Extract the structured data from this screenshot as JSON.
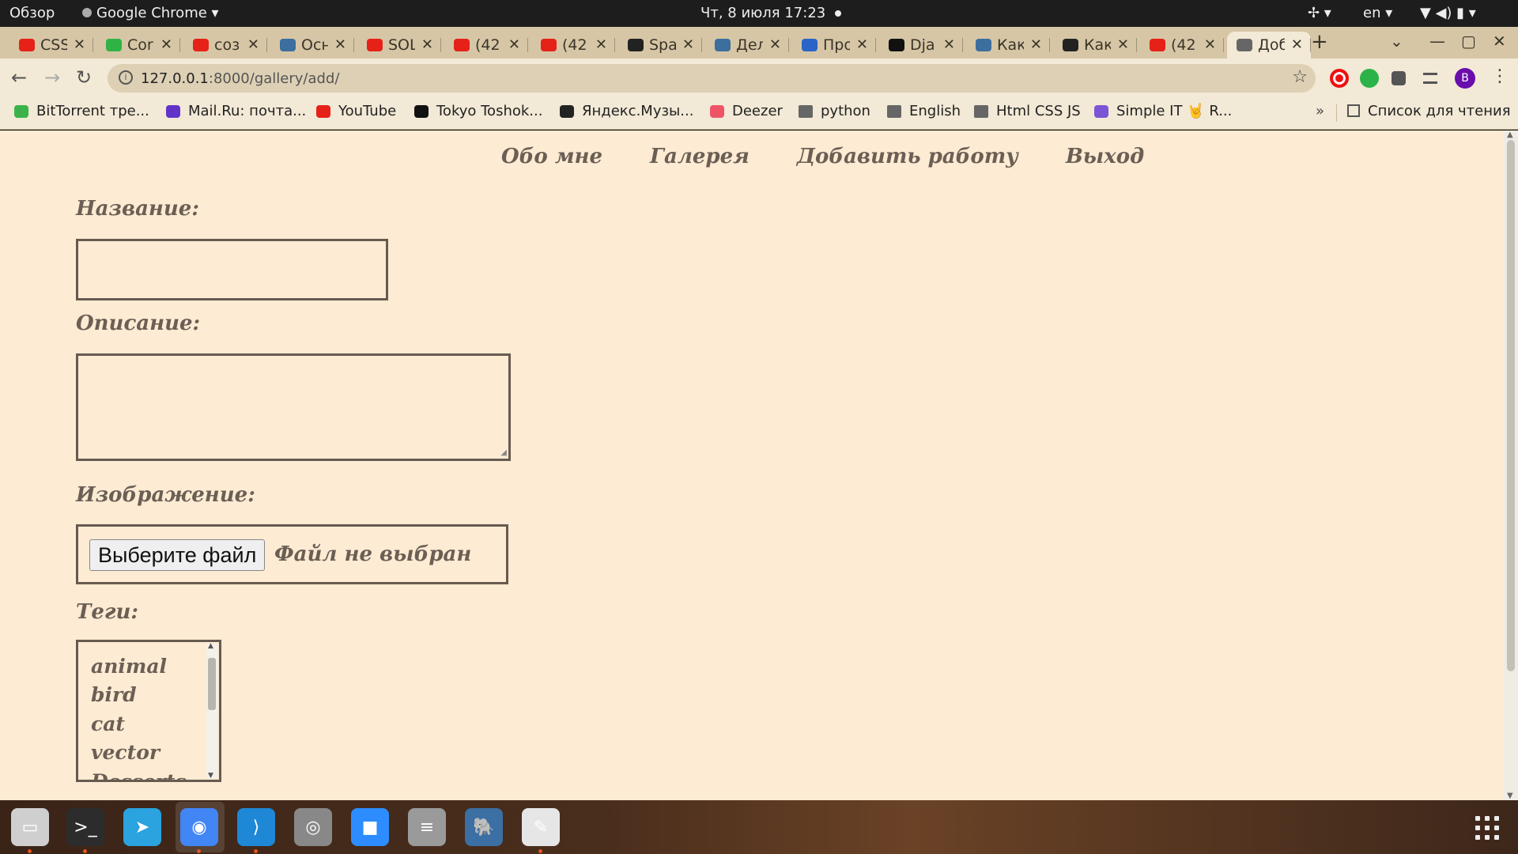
{
  "topbar": {
    "activities": "Обзор",
    "app_menu": "Google Chrome ▾",
    "datetime": "Чт, 8 июля  17:23",
    "lang": "en ▾",
    "a11y": "✢ ▾",
    "status": "▼ ◀) ▮ ▾"
  },
  "tabs": [
    {
      "title": "CSS",
      "color": "#e62117"
    },
    {
      "title": "Cor",
      "color": "#2fb344"
    },
    {
      "title": "соз",
      "color": "#e62117"
    },
    {
      "title": "Осн",
      "color": "#3c6e9e"
    },
    {
      "title": "SOL",
      "color": "#e62117"
    },
    {
      "title": "(42",
      "color": "#e62117"
    },
    {
      "title": "(42",
      "color": "#e62117"
    },
    {
      "title": "Spa",
      "color": "#222222"
    },
    {
      "title": "Дел",
      "color": "#3c6e9e"
    },
    {
      "title": "Про",
      "color": "#2a64c6"
    },
    {
      "title": "Dja",
      "color": "#111111"
    },
    {
      "title": "Как",
      "color": "#3c6e9e"
    },
    {
      "title": "Как",
      "color": "#222222"
    },
    {
      "title": "(42",
      "color": "#e62117"
    },
    {
      "title": "Доб",
      "color": "#666666"
    }
  ],
  "tab_close": "✕",
  "new_tab": "+",
  "window": {
    "tabsearch": "⌄",
    "minimize": "—",
    "restore": "▢",
    "close": "✕"
  },
  "toolbar": {
    "back": "←",
    "forward": "→",
    "reload": "↻",
    "url_host": "127.0.0.1",
    "url_rest": ":8000/gallery/add/",
    "info": "i",
    "star": "☆",
    "avatar": "B",
    "menu": "⋮"
  },
  "bookmarks": [
    {
      "label": "BitTorrent тре...",
      "icon": "bittorrent-icon",
      "color": "#3bb34a"
    },
    {
      "label": "Mail.Ru: почта...",
      "icon": "mailru-icon",
      "color": "#6233c9"
    },
    {
      "label": "YouTube",
      "icon": "youtube-icon",
      "color": "#e62117"
    },
    {
      "label": "Tokyo Toshok...",
      "icon": "tokyo-icon",
      "color": "#111111"
    },
    {
      "label": "Яндекс.Музы...",
      "icon": "yandex-music-icon",
      "color": "#222222"
    },
    {
      "label": "Deezer",
      "icon": "deezer-icon",
      "color": "#ef5466"
    },
    {
      "label": "python",
      "icon": "folder-icon",
      "color": "#666666"
    },
    {
      "label": "English",
      "icon": "folder-icon",
      "color": "#666666"
    },
    {
      "label": "Html CSS JS",
      "icon": "folder-icon",
      "color": "#666666"
    },
    {
      "label": "Simple IT 🤘 R...",
      "icon": "simple-it-icon",
      "color": "#7b55d6"
    }
  ],
  "bookmarks_more": "»",
  "reading_list": "Список для чтения",
  "site": {
    "nav": [
      "Обо мне",
      "Галерея",
      "Добавить работу",
      "Выход"
    ],
    "form": {
      "title_label": "Название:",
      "description_label": "Описание:",
      "image_label": "Изображение:",
      "file_button": "Выберите файл",
      "file_status": "Файл не выбран",
      "tags_label": "Теги:",
      "tags": [
        "animal",
        "bird",
        "cat",
        "vector",
        "Desserts"
      ]
    }
  },
  "dock": [
    {
      "name": "files-app-icon",
      "color": "#cfcfcf",
      "glyph": "▭"
    },
    {
      "name": "terminal-app-icon",
      "color": "#2c2c2c",
      "glyph": ">_"
    },
    {
      "name": "telegram-app-icon",
      "color": "#2aa3df",
      "glyph": "➤"
    },
    {
      "name": "chrome-app-icon",
      "color": "#4285f4",
      "glyph": "◉"
    },
    {
      "name": "vscode-app-icon",
      "color": "#1e88d6",
      "glyph": "⟩"
    },
    {
      "name": "screenshot-app-icon",
      "color": "#888888",
      "glyph": "◎"
    },
    {
      "name": "zoom-app-icon",
      "color": "#2d8cff",
      "glyph": "■"
    },
    {
      "name": "database-app-icon",
      "color": "#9a9a9a",
      "glyph": "≡"
    },
    {
      "name": "postgresql-app-icon",
      "color": "#3c6fa3",
      "glyph": "🐘"
    },
    {
      "name": "text-editor-app-icon",
      "color": "#e6e6e6",
      "glyph": "✎"
    }
  ]
}
